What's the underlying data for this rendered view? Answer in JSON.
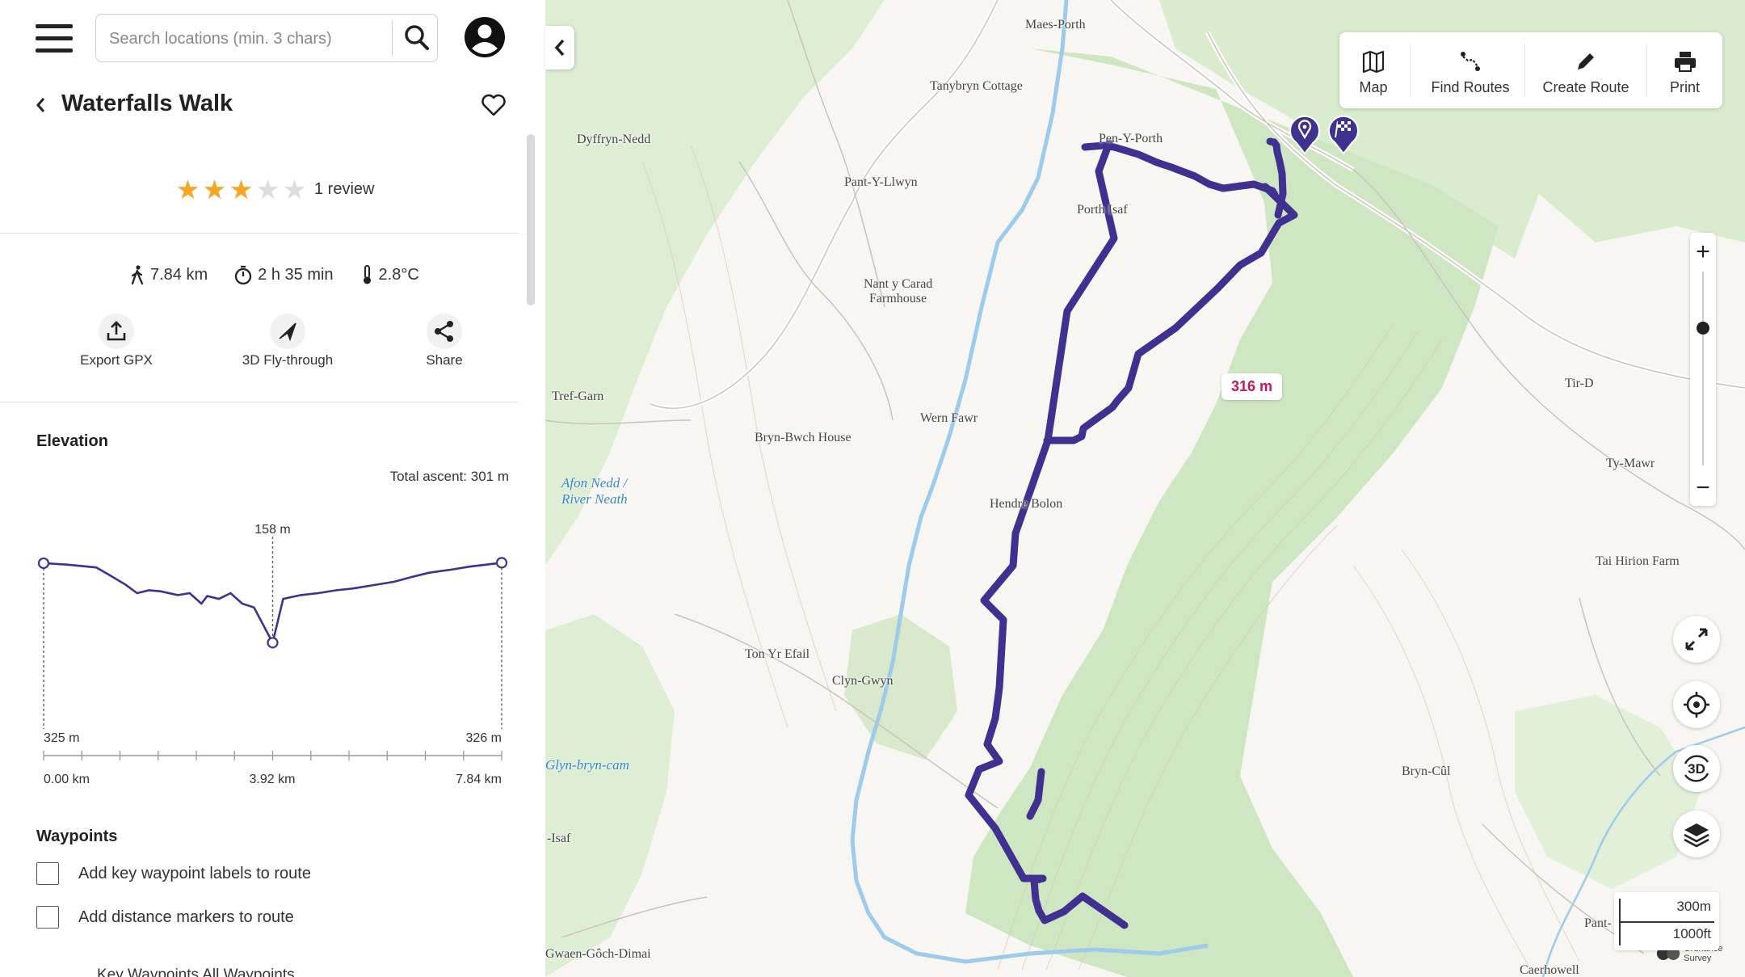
{
  "search": {
    "placeholder": "Search locations (min. 3 chars)"
  },
  "route": {
    "title": "Waterfalls Walk",
    "rating": 3,
    "max_rating": 5,
    "review_label": "1 review"
  },
  "stats": {
    "distance": "7.84 km",
    "duration": "2 h 35 min",
    "temperature": "2.8°C"
  },
  "actions": [
    {
      "label": "Export GPX",
      "icon": "upload-icon"
    },
    {
      "label": "3D Fly-through",
      "icon": "plane-icon"
    },
    {
      "label": "Share",
      "icon": "share-icon"
    }
  ],
  "elevation": {
    "title": "Elevation",
    "total_ascent": "Total ascent: 301 m",
    "start_label": "325 m",
    "end_label": "326 m",
    "min_label": "158 m",
    "x_labels": [
      "0.00 km",
      "3.92 km",
      "7.84 km"
    ]
  },
  "chart_data": {
    "type": "line",
    "xlabel": "",
    "ylabel": "",
    "x": [
      0.0,
      0.4,
      0.9,
      1.1,
      1.4,
      1.6,
      1.8,
      2.0,
      2.3,
      2.5,
      2.7,
      2.8,
      3.0,
      3.2,
      3.4,
      3.6,
      3.92,
      4.1,
      4.4,
      4.7,
      5.0,
      5.3,
      5.6,
      6.0,
      6.3,
      6.6,
      7.0,
      7.3,
      7.84
    ],
    "y": [
      325,
      322,
      316,
      302,
      280,
      262,
      268,
      266,
      258,
      262,
      240,
      256,
      250,
      262,
      240,
      232,
      158,
      250,
      258,
      262,
      268,
      272,
      278,
      286,
      296,
      305,
      312,
      318,
      326
    ],
    "xlim": [
      0,
      7.84
    ],
    "annotations": [
      "325 m",
      "158 m",
      "326 m"
    ]
  },
  "waypoints": {
    "title": "Waypoints",
    "opt1": "Add key waypoint labels to route",
    "opt2": "Add distance markers to route",
    "cut_tabs": "Key Waypoints                 All Waypoints"
  },
  "toolbar": {
    "map": "Map",
    "find": "Find Routes",
    "create": "Create Route",
    "print": "Print"
  },
  "map": {
    "distance_marker": "316 m",
    "scale_metric": "300m",
    "scale_imperial": "1000ft",
    "zoom_in": "+",
    "zoom_out": "−",
    "btn_3d": "3D",
    "route_color": "#3f318f",
    "places": [
      "Maes-Porth",
      "Tanybryn Cottage",
      "Pen-Y-Porth",
      "Dyffryn-Nedd",
      "Pant-Y-Llwyn",
      "Porth Isaf",
      "Nant y Carad",
      "Farmhouse",
      "Tref-Garn",
      "Wern Fawr",
      "Bryn-Bwch House",
      "Hendre Bolon",
      "Ton Yr Efail",
      "Clyn-Gwyn",
      "Tir-D",
      "Ty-Mawr",
      "Tai Hirion Farm",
      "Bryn-Cûl",
      "Pant-",
      "Caerhowell",
      "-Isaf",
      "Gwaen-Gôch-Dimai"
    ],
    "water_labels": [
      "Afon Nedd /",
      "River Neath",
      "Glyn-bryn-cam"
    ],
    "os_label": "Ordnance Survey"
  }
}
